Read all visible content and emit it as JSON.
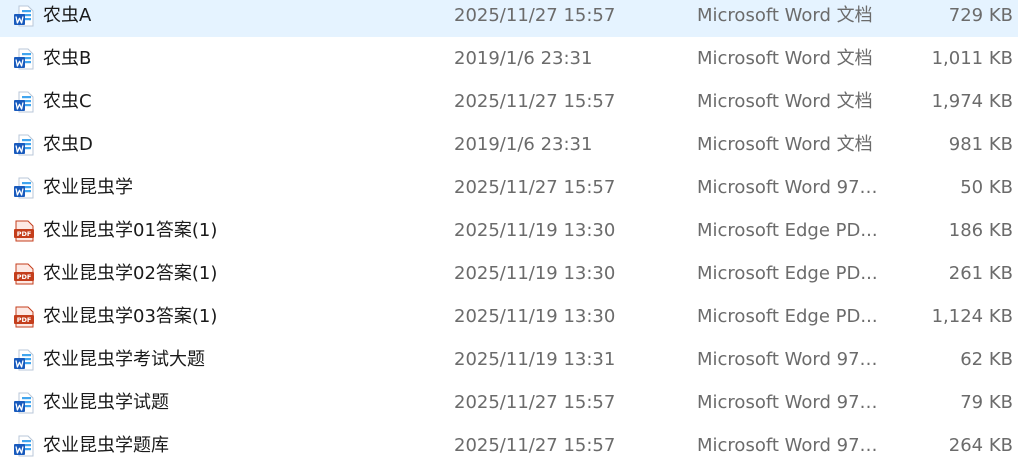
{
  "colors": {
    "word_blue": "#185abd",
    "word_light": "#41a5ee",
    "pdf_red": "#c43e1c",
    "pdf_paper": "#fde9e4",
    "name_text": "#1a1a1a",
    "meta_text": "#6b6b6b"
  },
  "files": [
    {
      "icon": "word-document-icon",
      "name": "农虫A",
      "date": "2025/11/27 15:57",
      "type": "Microsoft Word 文档",
      "size": "729 KB"
    },
    {
      "icon": "word-document-icon",
      "name": "农虫B",
      "date": "2019/1/6 23:31",
      "type": "Microsoft Word 文档",
      "size": "1,011 KB"
    },
    {
      "icon": "word-document-icon",
      "name": "农虫C",
      "date": "2025/11/27 15:57",
      "type": "Microsoft Word 文档",
      "size": "1,974 KB"
    },
    {
      "icon": "word-document-icon",
      "name": "农虫D",
      "date": "2019/1/6 23:31",
      "type": "Microsoft Word 文档",
      "size": "981 KB"
    },
    {
      "icon": "word-document-icon",
      "name": "农业昆虫学",
      "date": "2025/11/27 15:57",
      "type": "Microsoft Word 97 ...",
      "size": "50 KB"
    },
    {
      "icon": "pdf-document-icon",
      "icon_label": "PDF",
      "name": "农业昆虫学01答案(1)",
      "date": "2025/11/19 13:30",
      "type": "Microsoft Edge PD...",
      "size": "186 KB"
    },
    {
      "icon": "pdf-document-icon",
      "icon_label": "PDF",
      "name": "农业昆虫学02答案(1)",
      "date": "2025/11/19 13:30",
      "type": "Microsoft Edge PD...",
      "size": "261 KB"
    },
    {
      "icon": "pdf-document-icon",
      "icon_label": "PDF",
      "name": "农业昆虫学03答案(1)",
      "date": "2025/11/19 13:30",
      "type": "Microsoft Edge PD...",
      "size": "1,124 KB"
    },
    {
      "icon": "word-document-icon",
      "name": "农业昆虫学考试大题",
      "date": "2025/11/19 13:31",
      "type": "Microsoft Word 97 ...",
      "size": "62 KB"
    },
    {
      "icon": "word-document-icon",
      "name": "农业昆虫学试题",
      "date": "2025/11/27 15:57",
      "type": "Microsoft Word 97 ...",
      "size": "79 KB"
    },
    {
      "icon": "word-document-icon",
      "name": "农业昆虫学题库",
      "date": "2025/11/27 15:57",
      "type": "Microsoft Word 97 ...",
      "size": "264 KB"
    }
  ]
}
